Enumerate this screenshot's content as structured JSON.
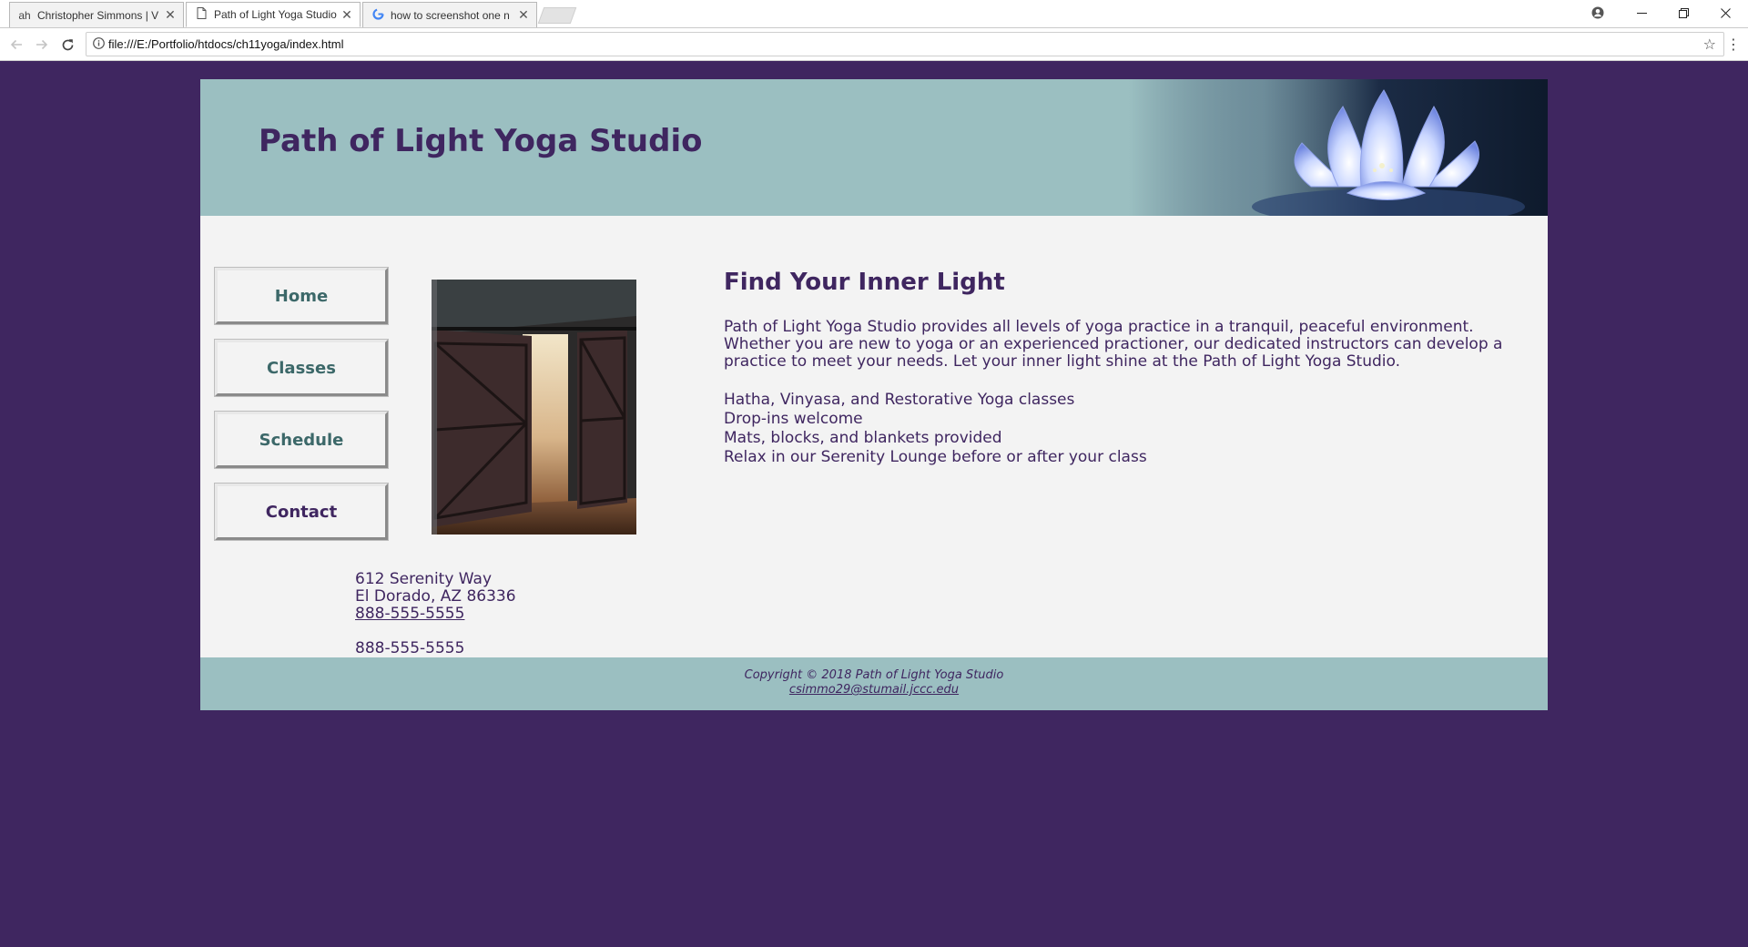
{
  "browser": {
    "tabs": [
      {
        "icon": "ah",
        "title": "Christopher Simmons | V",
        "active": false
      },
      {
        "icon": "document-icon",
        "title": "Path of Light Yoga Studio",
        "active": true
      },
      {
        "icon": "google-icon",
        "title": "how to screenshot one n",
        "active": false
      }
    ],
    "close_glyph": "✕",
    "url": "file:///E:/Portfolio/htdocs/ch11yoga/index.html"
  },
  "colors": {
    "background": "#3f2660",
    "banner": "#9bbfc1",
    "page": "#f3f3f3",
    "text": "#3f2660",
    "nav_text": "#3c6869"
  },
  "site": {
    "title": "Path of Light Yoga Studio",
    "nav": [
      {
        "label": "Home"
      },
      {
        "label": "Classes"
      },
      {
        "label": "Schedule"
      },
      {
        "label": "Contact"
      }
    ],
    "heading": "Find Your Inner Light",
    "intro": "Path of Light Yoga Studio provides all levels of yoga practice in a tranquil, peaceful environment. Whether you are new to yoga or an experienced practioner, our dedicated instructors can develop a practice to meet your needs. Let your inner light shine at the Path of Light Yoga Studio.",
    "features": [
      "Hatha, Vinyasa, and Restorative Yoga classes",
      "Drop-ins welcome",
      "Mats, blocks, and blankets provided",
      "Relax in our Serenity Lounge before or after your class"
    ],
    "contact": {
      "street": "612 Serenity Way",
      "city": "El Dorado, AZ 86336",
      "phone_link": "888-555-5555",
      "phone": "888-555-5555"
    },
    "footer": {
      "copyright": "Copyright © 2018 Path of Light Yoga Studio",
      "email": "csimmo29@stumail.jccc.edu"
    }
  }
}
